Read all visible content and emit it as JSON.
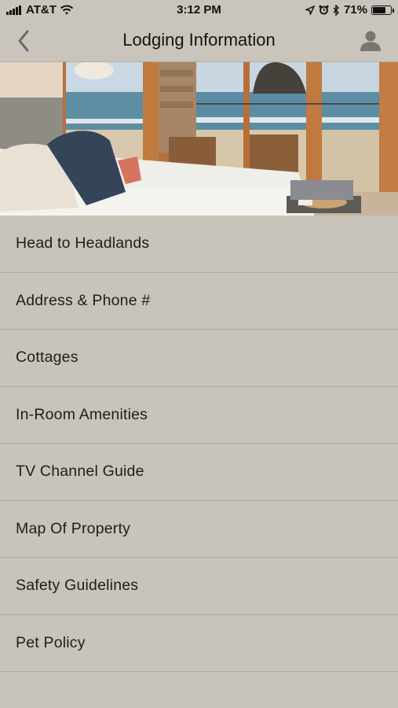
{
  "status_bar": {
    "carrier": "AT&T",
    "time": "3:12 PM",
    "battery": "71%",
    "battery_level": 0.71
  },
  "nav": {
    "title": "Lodging Information",
    "back_icon": "chevron-left-icon",
    "profile_icon": "user-icon"
  },
  "menu": {
    "items": [
      {
        "label": "Head to Headlands"
      },
      {
        "label": "Address & Phone #"
      },
      {
        "label": "Cottages"
      },
      {
        "label": "In-Room Amenities"
      },
      {
        "label": "TV Channel Guide"
      },
      {
        "label": "Map Of Property"
      },
      {
        "label": "Safety Guidelines"
      },
      {
        "label": "Pet Policy"
      }
    ]
  },
  "colors": {
    "background": "#c8c4bb",
    "divider": "#afaba2",
    "text": "#1e1e1e"
  }
}
